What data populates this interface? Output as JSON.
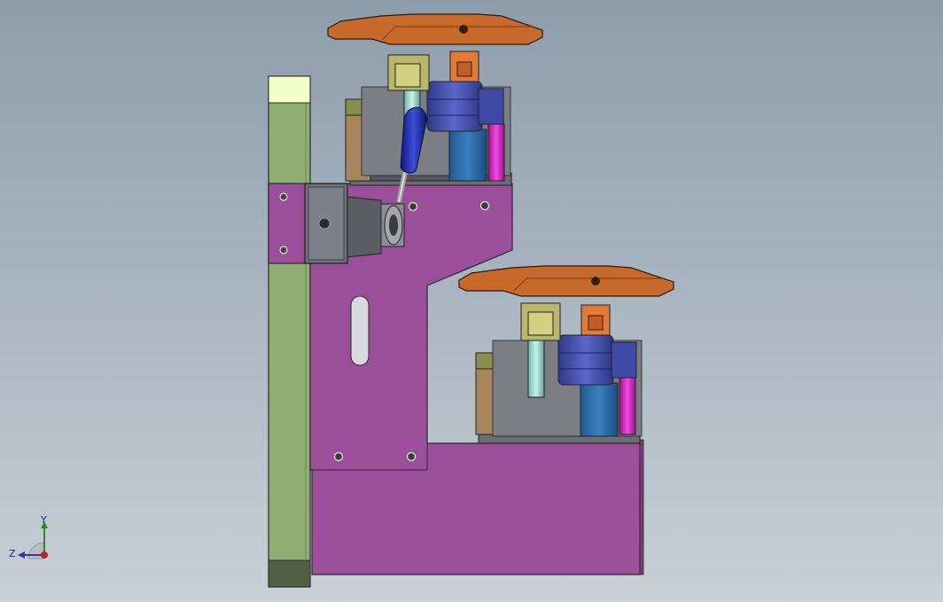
{
  "view": {
    "type": "cad-3d-model-viewport",
    "background_top": "#8e9dac",
    "background_bottom": "#c9d0d6"
  },
  "colors": {
    "plate_purple": "#9b4f9a",
    "rail_green": "#8fae74",
    "rail_cap": "#f2ffc8",
    "gripper_orange": "#c86a2c",
    "cylinder_blue": "#4a57b8",
    "handle_blue": "#1c2a9a",
    "magenta_part": "#d627c4",
    "housing_gray": "#6e7178",
    "tan_block": "#a7865e"
  },
  "triad": {
    "axis_y": "Y",
    "axis_z": "Z",
    "icon": "coordinate-triad-icon"
  }
}
